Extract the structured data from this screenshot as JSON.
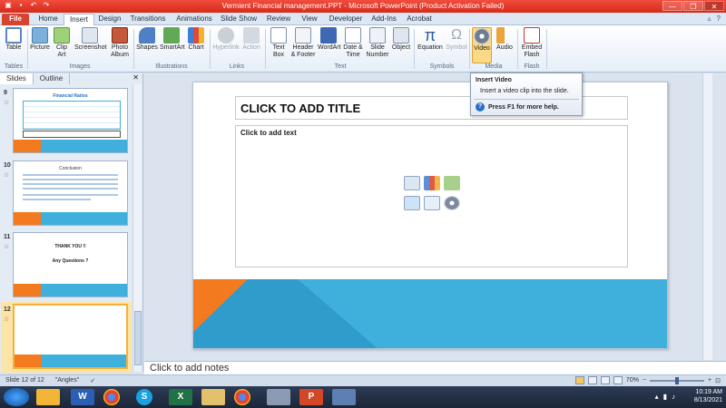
{
  "window": {
    "title": "Vermient Financial management.PPT  -  Microsoft PowerPoint (Product Activation Failed)",
    "controls": [
      "—",
      "❐",
      "✕"
    ]
  },
  "tabs": [
    "File",
    "Home",
    "Insert",
    "Design",
    "Transitions",
    "Animations",
    "Slide Show",
    "Review",
    "View",
    "Developer",
    "Add-Ins",
    "Acrobat"
  ],
  "active_tab": "Insert",
  "ribbon": {
    "buttons": {
      "table": "Table",
      "picture": "Picture",
      "clip_art": "Clip Art",
      "screenshot": "Screenshot",
      "photo_album": "Photo Album",
      "shapes": "Shapes",
      "smartart": "SmartArt",
      "chart": "Chart",
      "hyperlink": "Hyperlink",
      "action": "Action",
      "text_box": "Text Box",
      "header_footer": "Header & Footer",
      "wordart": "WordArt",
      "date_time": "Date & Time",
      "slide_number": "Slide Number",
      "object": "Object",
      "equation": "Equation",
      "symbol": "Symbol",
      "video": "Video",
      "audio": "Audio",
      "embed_flash": "Embed Flash"
    },
    "groups": [
      "Tables",
      "Images",
      "Illustrations",
      "Links",
      "Text",
      "Symbols",
      "Media",
      "Flash"
    ]
  },
  "tooltip": {
    "title": "Insert Video",
    "description": "Insert a video clip into the slide.",
    "help": "Press F1 for more help."
  },
  "panel": {
    "tabs": [
      "Slides",
      "Outline"
    ],
    "active_tab": "Slides",
    "slides": [
      {
        "number": "9",
        "title": "Financial Ratios"
      },
      {
        "number": "10",
        "title": "Conclusion"
      },
      {
        "number": "11",
        "title": "THANK YOU !!",
        "subtitle": "Any Questions ?"
      },
      {
        "number": "12",
        "title": ""
      }
    ]
  },
  "slide": {
    "title_placeholder": "CLICK TO ADD TITLE",
    "body_placeholder": "Click to add text"
  },
  "notes": {
    "placeholder": "Click to add notes"
  },
  "status": {
    "slide_info": "Slide 12 of 12",
    "theme": "\"Angles\"",
    "zoom": "70%"
  },
  "clock": {
    "time": "10:19 AM",
    "date": "8/13/2021"
  },
  "colors": {
    "accent_orange": "#f47a20",
    "accent_blue": "#3fb0dc",
    "titlebar": "#e0342a"
  }
}
